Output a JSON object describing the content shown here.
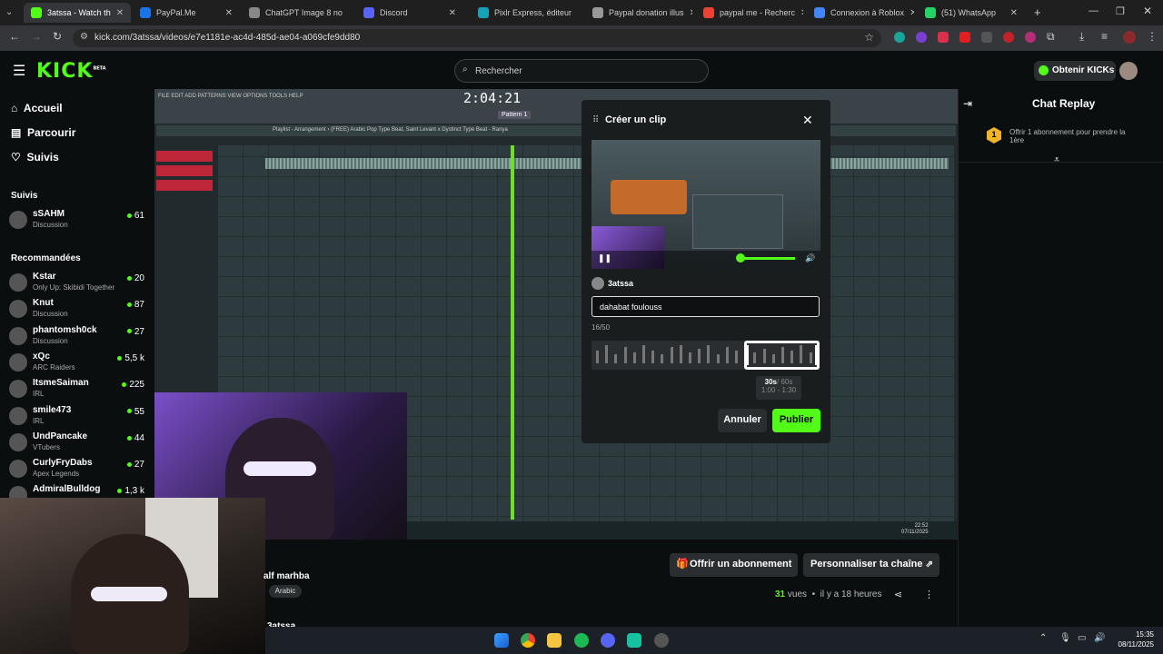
{
  "browser": {
    "tabs": [
      {
        "title": "3atssa - Watch th",
        "active": true,
        "color": "#53fc18"
      },
      {
        "title": "PayPal.Me",
        "color": "#1a73e8"
      },
      {
        "title": "ChatGPT Image 8 no",
        "color": "#888888"
      },
      {
        "title": "Discord",
        "color": "#5865f2"
      },
      {
        "title": "Pixlr Express, éditeur",
        "color": "#17a2b8"
      },
      {
        "title": "Paypal donation illus",
        "color": "#999999"
      },
      {
        "title": "paypal me - Recherc",
        "color": "#ea4335"
      },
      {
        "title": "Connexion à Roblox",
        "color": "#4285f4"
      },
      {
        "title": "(51) WhatsApp",
        "color": "#25d366"
      }
    ],
    "url": "kick.com/3atssa/videos/e7e1181e-ac4d-485d-ae04-a069cfe9dd80"
  },
  "header": {
    "logo": "KICK",
    "logo_beta": "BETA",
    "search_placeholder": "Rechercher",
    "get_kicks": "Obtenir KICKs"
  },
  "sidebar": {
    "nav": [
      "Accueil",
      "Parcourir",
      "Suivis"
    ],
    "followed_title": "Suivis",
    "followed": [
      {
        "name": "sSAHM",
        "category": "Discussion",
        "viewers": "61"
      }
    ],
    "recommended_title": "Recommandées",
    "recommended": [
      {
        "name": "Kstar",
        "category": "Only Up: Skibidi Together",
        "viewers": "20"
      },
      {
        "name": "Knut",
        "category": "Discussion",
        "viewers": "87"
      },
      {
        "name": "phantomsh0ck",
        "category": "Discussion",
        "viewers": "27"
      },
      {
        "name": "xQc",
        "category": "ARC Raiders",
        "viewers": "5,5 k"
      },
      {
        "name": "ItsmeSaiman",
        "category": "IRL",
        "viewers": "225"
      },
      {
        "name": "smile473",
        "category": "IRL",
        "viewers": "55"
      },
      {
        "name": "UndPancake",
        "category": "VTubers",
        "viewers": "44"
      },
      {
        "name": "CurlyFryDabs",
        "category": "Apex Legends",
        "viewers": "27"
      },
      {
        "name": "AdmiralBulldog",
        "category": "",
        "viewers": "1,3 k"
      }
    ]
  },
  "video": {
    "fl_time": "2:04:21",
    "fl_pattern": "Pattern 1",
    "fl_menu": "FILE EDIT ADD PATTERNS VIEW OPTIONS TOOLS HELP",
    "fl_playlist": "Playlist - Arrangement › (FREE) Arabic Pop Type Beat, Saint Levant x Dystinct Type Beat - Ranya",
    "fl_clock": "22:52",
    "fl_date": "07/11/2025"
  },
  "clip_modal": {
    "title": "Créer un clip",
    "author": "3atssa",
    "input_value": "dahabat foulouss",
    "char_count": "16/50",
    "duration_selected": "30s",
    "duration_max": "/ 60s",
    "range": "1:00 - 1:30",
    "cancel": "Annuler",
    "publish": "Publier"
  },
  "below_video": {
    "subscribe": "Offrir un abonnement",
    "customize": "Personnaliser ta chaîne",
    "title_partial": "alf marhba",
    "tag": "Arabic",
    "views_count": "31",
    "views_label": "vues",
    "time_ago": "il y a 18 heures",
    "channel_partial": "3atssa"
  },
  "chat": {
    "title": "Chat Replay",
    "gift_badge": "1",
    "gift_text": "Offrir 1 abonnement pour prendre la 1ère"
  },
  "taskbar": {
    "time": "15:35",
    "date": "08/11/2025"
  }
}
